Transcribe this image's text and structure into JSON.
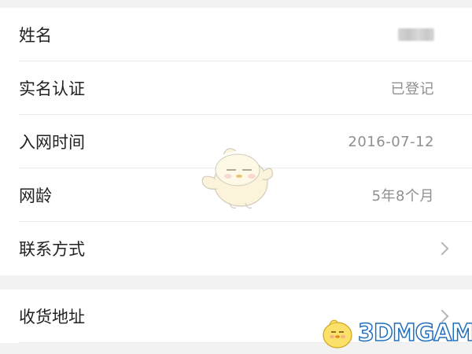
{
  "profile": {
    "rows": [
      {
        "label": "姓名",
        "value": "",
        "kind": "blurred"
      },
      {
        "label": "实名认证",
        "value": "已登记",
        "kind": "text"
      },
      {
        "label": "入网时间",
        "value": "2016-07-12",
        "kind": "text"
      },
      {
        "label": "网龄",
        "value": "5年8个月",
        "kind": "text"
      },
      {
        "label": "联系方式",
        "value": "",
        "kind": "chevron"
      }
    ]
  },
  "shipping": {
    "rows": [
      {
        "label": "收货地址",
        "value": "",
        "kind": "chevron"
      }
    ]
  },
  "watermark": {
    "text": "3DMGAME"
  },
  "icons": {
    "chevron": "chevron-right-icon",
    "mascot": "bird-mascot-icon",
    "watermark_logo": "3dm-mascot-logo-icon"
  },
  "colors": {
    "background": "#f2f2f2",
    "row_background": "#ffffff",
    "label_text": "#222222",
    "value_text": "#8f8f8f",
    "watermark_outline": "#1f6fc0"
  }
}
